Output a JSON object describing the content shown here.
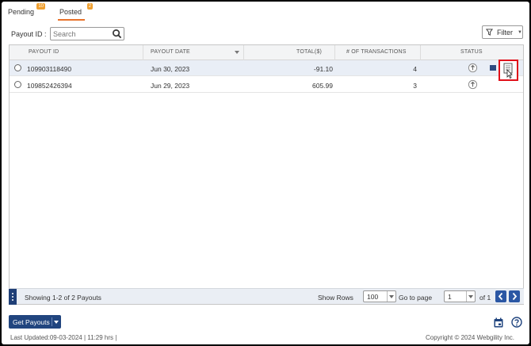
{
  "tabs": [
    {
      "label": "Pending",
      "badge": "10"
    },
    {
      "label": "Posted",
      "badge": "2"
    }
  ],
  "toolbar": {
    "payout_id_label": "Payout ID :",
    "search_placeholder": "Search",
    "filter_label": "Filter"
  },
  "table": {
    "columns": [
      "PAYOUT ID",
      "PAYOUT DATE",
      "TOTAL($)",
      "# OF TRANSACTIONS",
      "STATUS"
    ],
    "rows": [
      {
        "payout_id": "109903118490",
        "date": "Jun 30, 2023",
        "total": "-91.10",
        "transactions": "4"
      },
      {
        "payout_id": "109852426394",
        "date": "Jun 29, 2023",
        "total": "605.99",
        "transactions": "3"
      }
    ]
  },
  "pager": {
    "showing": "Showing 1-2 of 2 Payouts",
    "show_rows_label": "Show Rows",
    "rows_value": "100",
    "goto_label": "Go to page",
    "page_value": "1",
    "of_label": "of 1"
  },
  "actions": {
    "get_payouts": "Get Payouts"
  },
  "footer": {
    "last_updated": "Last Updated:09-03-2024 | 11:29 hrs |",
    "copyright": "Copyright © 2024 Webgility Inc."
  },
  "colors": {
    "accent": "#21457f",
    "tab_underline": "#e8722a",
    "highlight_box": "#e0101a"
  }
}
